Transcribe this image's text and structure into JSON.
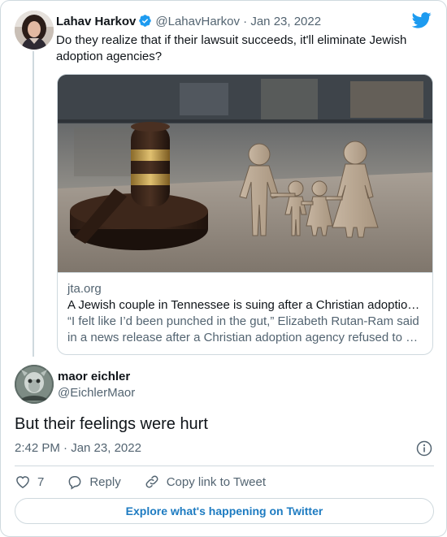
{
  "parent_tweet": {
    "author_name": "Lahav Harkov",
    "author_handle": "@LahavHarkov",
    "separator": "·",
    "date": "Jan 23, 2022",
    "text": "Do they realize that if their lawsuit succeeds, it'll eliminate Jewish adoption agencies?",
    "link_card": {
      "domain": "jta.org",
      "title": "A Jewish couple in Tennessee is suing after a Christian adoptio…",
      "description": "“I felt like I’d been punched in the gut,” Elizabeth Rutan-Ram said in a news release after a Christian adoption agency refused to …"
    }
  },
  "main_tweet": {
    "author_name": "maor eichler",
    "author_handle": "@EichlerMaor",
    "text": "But their feelings were hurt",
    "timestamp": "2:42 PM · Jan 23, 2022"
  },
  "actions": {
    "like_count": "7",
    "reply_label": "Reply",
    "copy_link_label": "Copy link to Tweet"
  },
  "explore_label": "Explore what's happening on Twitter",
  "colors": {
    "twitter_blue": "#1d9bf0",
    "text_primary": "#0f1419",
    "text_secondary": "#536471",
    "border": "#cfd9de",
    "explore_text": "#1d7bc1"
  }
}
